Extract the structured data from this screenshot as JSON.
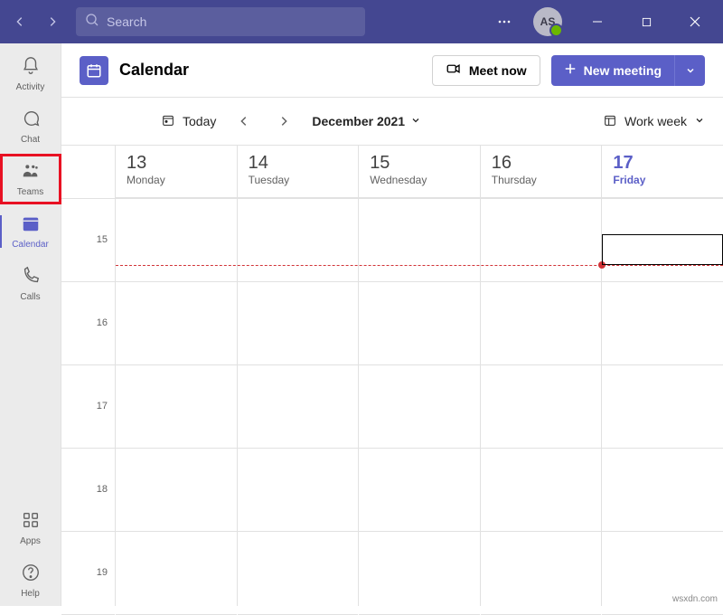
{
  "title_bar": {
    "search_placeholder": "Search",
    "avatar_initials": "AS"
  },
  "rail": {
    "activity": "Activity",
    "chat": "Chat",
    "teams": "Teams",
    "calendar": "Calendar",
    "calls": "Calls",
    "apps": "Apps",
    "help": "Help"
  },
  "header": {
    "title": "Calendar",
    "meet_now": "Meet now",
    "new_meeting": "New meeting"
  },
  "toolbar": {
    "today": "Today",
    "month": "December 2021",
    "view": "Work week"
  },
  "days": [
    {
      "num": "13",
      "name": "Monday",
      "today": false
    },
    {
      "num": "14",
      "name": "Tuesday",
      "today": false
    },
    {
      "num": "15",
      "name": "Wednesday",
      "today": false
    },
    {
      "num": "16",
      "name": "Thursday",
      "today": false
    },
    {
      "num": "17",
      "name": "Friday",
      "today": true
    }
  ],
  "hours": [
    "15",
    "16",
    "17",
    "18",
    "19"
  ],
  "watermark": "wsxdn.com"
}
